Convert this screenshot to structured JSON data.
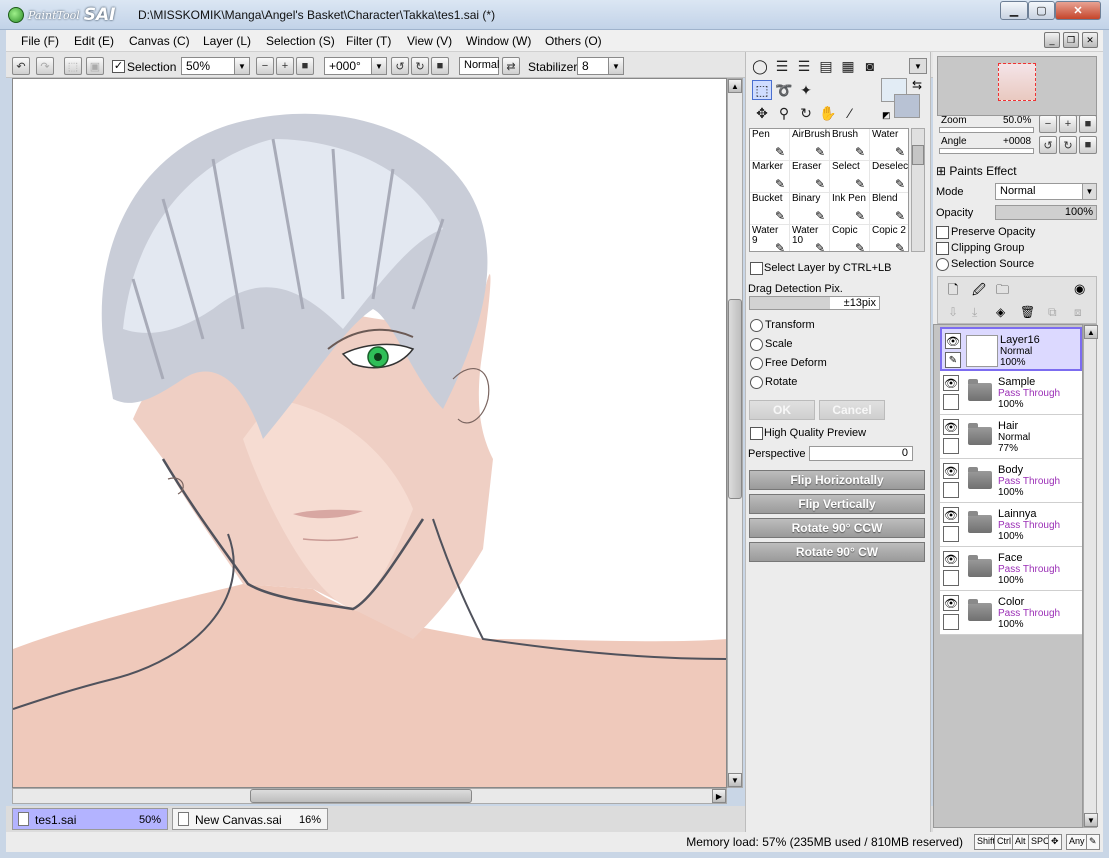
{
  "window": {
    "app_name_small": "PaintTool",
    "app_name_big": "SAI",
    "title": "D:\\MISSKOMIK\\Manga\\Angel's Basket\\Character\\Takka\\tes1.sai (*)"
  },
  "menu": [
    "File (F)",
    "Edit (E)",
    "Canvas (C)",
    "Layer (L)",
    "Selection (S)",
    "Filter (T)",
    "View (V)",
    "Window (W)",
    "Others (O)"
  ],
  "toolbar": {
    "selection_label": "Selection",
    "selection_checked": true,
    "zoom": "50%",
    "angle": "+000°",
    "blend": "Normal",
    "stabilizer_label": "Stabilizer",
    "stabilizer": "8"
  },
  "tools": {
    "brushes": [
      {
        "name": "Pen",
        "icon": "pen-icon"
      },
      {
        "name": "AirBrush",
        "icon": "airbrush-icon"
      },
      {
        "name": "Brush",
        "icon": "brush-icon"
      },
      {
        "name": "Water",
        "icon": "water-icon"
      },
      {
        "name": "Marker",
        "icon": "marker-icon"
      },
      {
        "name": "Eraser",
        "icon": "eraser-icon"
      },
      {
        "name": "Select",
        "icon": "select-icon"
      },
      {
        "name": "Deselect",
        "icon": "deselect-icon"
      },
      {
        "name": "Bucket",
        "icon": "bucket-icon"
      },
      {
        "name": "Binary",
        "icon": "binary-icon"
      },
      {
        "name": "Ink Pen",
        "icon": "inkpen-icon"
      },
      {
        "name": "Blend",
        "icon": "blend-icon"
      },
      {
        "name": "Water\n9",
        "icon": "water-icon"
      },
      {
        "name": "Water\n10",
        "icon": "water-icon"
      },
      {
        "name": "Copic",
        "icon": "copic-icon"
      },
      {
        "name": "Copic 2",
        "icon": "copic-icon"
      }
    ],
    "select_layer_ctrl": "Select Layer by CTRL+LB",
    "drag_detection_label": "Drag Detection Pix.",
    "drag_detection_value": "±13pix",
    "transform_options": [
      "Transform",
      "Scale",
      "Free Deform",
      "Rotate"
    ],
    "ok_label": "OK",
    "cancel_label": "Cancel",
    "high_quality_preview": "High Quality Preview",
    "perspective_label": "Perspective",
    "perspective_value": "0",
    "flip_h": "Flip Horizontally",
    "flip_v": "Flip Vertically",
    "rot_ccw": "Rotate 90° CCW",
    "rot_cw": "Rotate 90° CW"
  },
  "navigator": {
    "zoom_label": "Zoom",
    "zoom_value": "50.0%",
    "angle_label": "Angle",
    "angle_value": "+0008"
  },
  "layer_props": {
    "paints_effect": "Paints Effect",
    "mode_label": "Mode",
    "mode_value": "Normal",
    "opacity_label": "Opacity",
    "opacity_value": "100%",
    "preserve_opacity": "Preserve Opacity",
    "clipping_group": "Clipping Group",
    "selection_source": "Selection Source"
  },
  "layers": [
    {
      "name": "Layer16",
      "mode": "Normal",
      "opacity": "100%",
      "type": "layer",
      "selected": true
    },
    {
      "name": "Sample",
      "mode": "Pass Through",
      "opacity": "100%",
      "type": "folder"
    },
    {
      "name": "Hair",
      "mode": "Normal",
      "opacity": "77%",
      "type": "folder"
    },
    {
      "name": "Body",
      "mode": "Pass Through",
      "opacity": "100%",
      "type": "folder"
    },
    {
      "name": "Lainnya",
      "mode": "Pass Through",
      "opacity": "100%",
      "type": "folder"
    },
    {
      "name": "Face",
      "mode": "Pass Through",
      "opacity": "100%",
      "type": "folder"
    },
    {
      "name": "Color",
      "mode": "Pass Through",
      "opacity": "100%",
      "type": "folder"
    }
  ],
  "tabs": [
    {
      "name": "tes1.sai",
      "zoom": "50%",
      "active": true
    },
    {
      "name": "New Canvas.sai",
      "zoom": "16%",
      "active": false
    }
  ],
  "status": {
    "memory": "Memory load: 57% (235MB used / 810MB reserved)",
    "keys": [
      "Shift",
      "Ctrl",
      "Alt",
      "SPC",
      "Any"
    ]
  },
  "colors": {
    "skin": "#efc9bb",
    "hair": "#c9cdd8",
    "eye": "#2fbf58",
    "selected_layer": "#dcd9ff",
    "blend_purple": "#9b2fb6"
  }
}
